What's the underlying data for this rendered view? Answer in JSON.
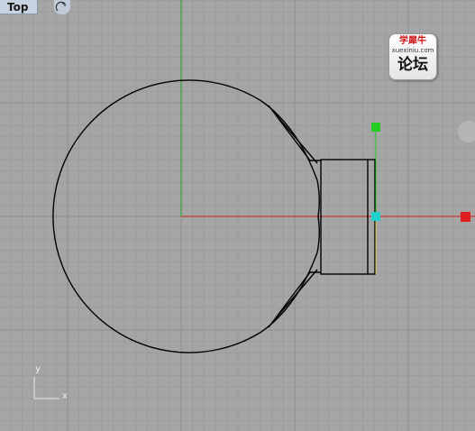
{
  "viewport": {
    "label": "Top",
    "background": "#a5a5a5",
    "grid_minor_color": "#9c9c9c",
    "grid_major_color": "#8e8e8e",
    "x_axis_color": "#c42020",
    "y_axis_color": "#1e9e1e",
    "camera_icon": "camera-rotate-icon"
  },
  "watermark": {
    "line1": "学犀牛",
    "line2": "xuexiniu.com",
    "line3": "论坛"
  },
  "gizmo": {
    "x_handle_color": "#e02020",
    "y_handle_color": "#22cc22",
    "center_color": "#22d0d0"
  },
  "axis_indicator": {
    "x_label": "x",
    "y_label": "y"
  }
}
